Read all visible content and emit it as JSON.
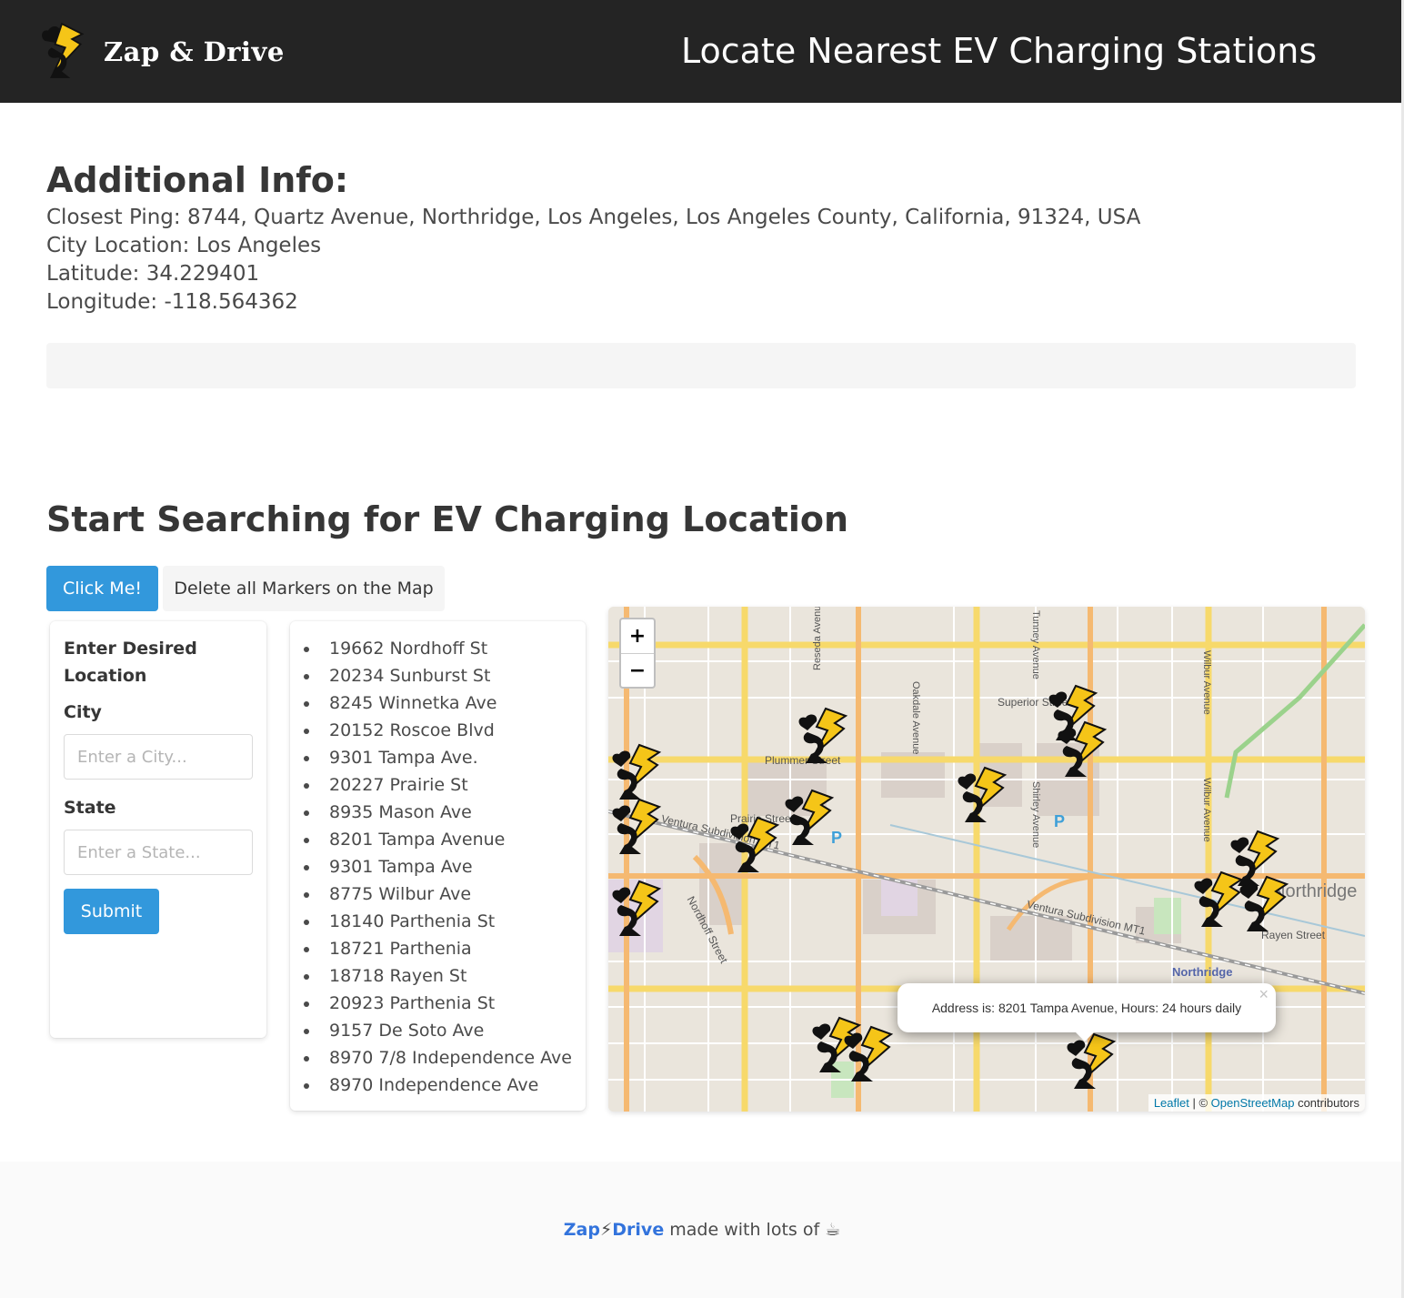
{
  "header": {
    "brand_name": "Zap & Drive",
    "title": "Locate Nearest EV Charging Stations"
  },
  "info": {
    "heading": "Additional Info:",
    "closest_ping": "Closest Ping: 8744, Quartz Avenue, Northridge, Los Angeles, Los Angeles County, California, 91324, USA",
    "city_location": "City Location: Los Angeles",
    "latitude": "Latitude: 34.229401",
    "longitude": "Longitude: -118.564362"
  },
  "search": {
    "heading": "Start Searching for EV Charging Location",
    "click_me_label": "Click Me!",
    "delete_markers_label": "Delete all Markers on the Map"
  },
  "form": {
    "title": "Enter Desired Location",
    "city_label": "City",
    "city_placeholder": "Enter a City...",
    "city_value": "",
    "state_label": "State",
    "state_placeholder": "Enter a State...",
    "state_value": "",
    "submit_label": "Submit"
  },
  "stations": [
    "19662 Nordhoff St",
    "20234 Sunburst St",
    "8245 Winnetka Ave",
    "20152 Roscoe Blvd",
    "9301 Tampa Ave.",
    "20227 Prairie St",
    "8935 Mason Ave",
    "8201 Tampa Avenue",
    "9301 Tampa Ave",
    "8775 Wilbur Ave",
    "18140 Parthenia St",
    "18721 Parthenia",
    "18718 Rayen St",
    "20923 Parthenia St",
    "9157 De Soto Ave",
    "8970 7/8 Independence Ave",
    "8970 Independence Ave"
  ],
  "map": {
    "zoom_in": "+",
    "zoom_out": "−",
    "popup_text": "Address is: 8201 Tampa Avenue, Hours: 24 hours daily",
    "popup_close": "×",
    "attribution_leaflet": "Leaflet",
    "attribution_sep": " | © ",
    "attribution_osm": "OpenStreetMap",
    "attribution_tail": " contributors",
    "labels": {
      "northridge_small": "Northridge",
      "northridge_large": "Northridge",
      "superior": "Superior Street",
      "plummer": "Plummer Street",
      "prairie": "Prairie Street",
      "rayen": "Rayen Street",
      "nordhoff": "Nordhoff Street",
      "ventura_1": "Ventura Subdivision MT1",
      "ventura_2": "Ventura Subdivision MT1",
      "oakdale": "Oakdale Avenue",
      "shirley": "Shirley Avenue",
      "wilbur_1": "Wilbur Avenue",
      "wilbur_2": "Wilbur Avenue",
      "tunney": "Tunney Avenue",
      "reseda": "Reseda Avenue",
      "parking_1": "P",
      "parking_2": "P"
    },
    "colors": {
      "primary_road": "#f7d96b",
      "secondary_road": "#f5b971",
      "land": "#eae5dc"
    }
  },
  "footer": {
    "brand_left": "Zap",
    "brand_bolt": "⚡",
    "brand_right": "Drive",
    "made_with": " made with lots of ",
    "icon": "☕"
  },
  "colors": {
    "navbar": "#242424",
    "primary": "#3298dc",
    "link": "#3273dc"
  }
}
